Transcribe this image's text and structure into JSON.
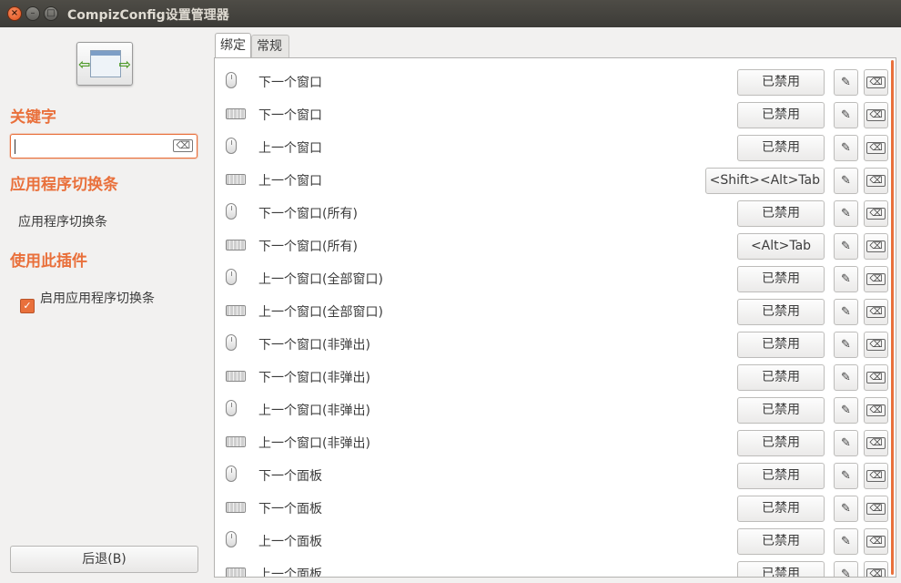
{
  "window": {
    "title": "CompizConfig设置管理器",
    "close_glyph": "×",
    "min_glyph": "–",
    "max_glyph": "□"
  },
  "sidebar": {
    "keyword_heading": "关键字",
    "search_value": "",
    "search_clear_glyph": "⌫",
    "plugin_heading": "应用程序切换条",
    "plugin_name": "应用程序切换条",
    "use_heading": "使用此插件",
    "enable_label": "启用应用程序切换条",
    "enable_checked": true,
    "check_glyph": "✓",
    "back_label": "后退(B)"
  },
  "tabs": [
    {
      "label": "绑定"
    },
    {
      "label": "常规"
    }
  ],
  "icons": {
    "edit_glyph": "✎",
    "clear_glyph": "⌫"
  },
  "rows": [
    {
      "icon": "mouse",
      "label": "下一个窗口",
      "value": "已禁用"
    },
    {
      "icon": "keyboard",
      "label": "下一个窗口",
      "value": "已禁用"
    },
    {
      "icon": "mouse",
      "label": "上一个窗口",
      "value": "已禁用"
    },
    {
      "icon": "keyboard",
      "label": "上一个窗口",
      "value": "<Shift><Alt>Tab"
    },
    {
      "icon": "mouse",
      "label": "下一个窗口(所有)",
      "value": "已禁用"
    },
    {
      "icon": "keyboard",
      "label": "下一个窗口(所有)",
      "value": "<Alt>Tab"
    },
    {
      "icon": "mouse",
      "label": "上一个窗口(全部窗口)",
      "value": "已禁用"
    },
    {
      "icon": "keyboard",
      "label": "上一个窗口(全部窗口)",
      "value": "已禁用"
    },
    {
      "icon": "mouse",
      "label": "下一个窗口(非弹出)",
      "value": "已禁用"
    },
    {
      "icon": "keyboard",
      "label": "下一个窗口(非弹出)",
      "value": "已禁用"
    },
    {
      "icon": "mouse",
      "label": "上一个窗口(非弹出)",
      "value": "已禁用"
    },
    {
      "icon": "keyboard",
      "label": "上一个窗口(非弹出)",
      "value": "已禁用"
    },
    {
      "icon": "mouse",
      "label": "下一个面板",
      "value": "已禁用"
    },
    {
      "icon": "keyboard",
      "label": "下一个面板",
      "value": "已禁用"
    },
    {
      "icon": "mouse",
      "label": "上一个面板",
      "value": "已禁用"
    },
    {
      "icon": "keyboard",
      "label": "上一个面板",
      "value": "已禁用"
    }
  ],
  "colors": {
    "accent": "#e9703b",
    "titlebar": "#3c3b37",
    "background": "#f2f1f0"
  }
}
